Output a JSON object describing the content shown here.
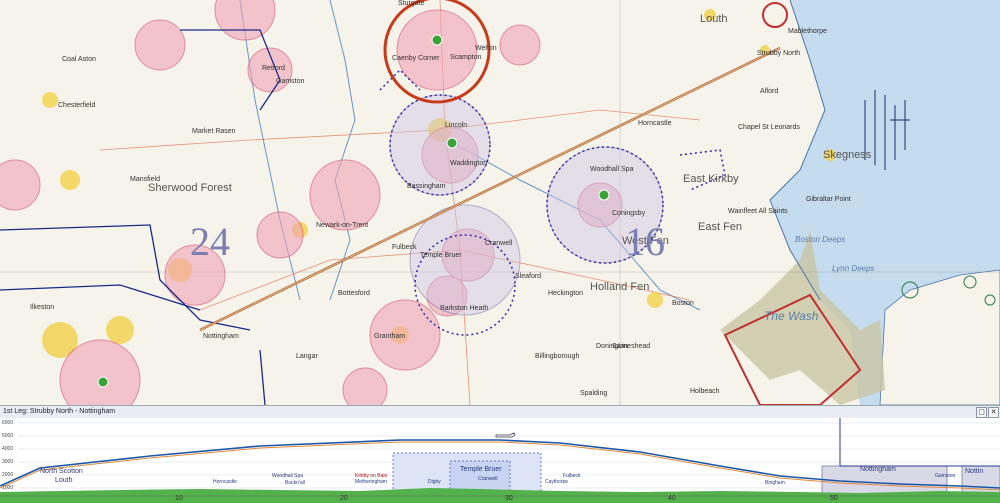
{
  "map": {
    "places": [
      {
        "text": "Sturgate"
      },
      {
        "text": "Caenby Corner"
      },
      {
        "text": "Scampton"
      },
      {
        "text": "Welton"
      },
      {
        "text": "Lincoln"
      },
      {
        "text": "Waddington"
      },
      {
        "text": "Bassingham"
      },
      {
        "text": "Coningsby"
      },
      {
        "text": "Woodhall Spa"
      },
      {
        "text": "East Kirkby"
      },
      {
        "text": "Skegness"
      },
      {
        "text": "Strubby North"
      },
      {
        "text": "Louth"
      },
      {
        "text": "Mablethorpe"
      },
      {
        "text": "Alford"
      },
      {
        "text": "Horncastle"
      },
      {
        "text": "Boston"
      },
      {
        "text": "Sleaford"
      },
      {
        "text": "Cranwell"
      },
      {
        "text": "Barkston Heath"
      },
      {
        "text": "Nottingham"
      },
      {
        "text": "Newark-on-Trent"
      },
      {
        "text": "Langar"
      },
      {
        "text": "Grantham"
      },
      {
        "text": "Gamston"
      },
      {
        "text": "Retford"
      },
      {
        "text": "Sherwood Forest"
      },
      {
        "text": "Chesterfield"
      },
      {
        "text": "Mansfield"
      },
      {
        "text": "Ilkeston"
      },
      {
        "text": "Market Rasen"
      },
      {
        "text": "Fulbeck"
      },
      {
        "text": "Temple Bruer"
      },
      {
        "text": "Bottesford"
      },
      {
        "text": "Heckington"
      },
      {
        "text": "Swineshead"
      },
      {
        "text": "Donington"
      },
      {
        "text": "Billingborough"
      },
      {
        "text": "Coal Aston"
      },
      {
        "text": "Wainfleet All Saints"
      },
      {
        "text": "Chapel St Leonards"
      },
      {
        "text": "Gibraltar Point"
      },
      {
        "text": "Spalding"
      },
      {
        "text": "Holbeach"
      }
    ],
    "features": {
      "wash": "The Wash",
      "lynn_deeps": "Lynn Deeps",
      "boston_deeps": "Boston Deeps",
      "west_fen": "West Fen",
      "east_fen": "East Fen",
      "holland_fen": "Holland Fen",
      "sector_24": "24",
      "sector_16": "16"
    }
  },
  "profile": {
    "title": "1st Leg: Strubby North - Nottingham",
    "btn_dock": "▢",
    "btn_close": "✕",
    "y_ticks": [
      "6000",
      "5000",
      "4000",
      "3000",
      "2000",
      "1000"
    ],
    "x_ticks": [
      "10",
      "20",
      "30",
      "40",
      "50"
    ],
    "labels": {
      "north_scotton": "North Scotton",
      "louth": "Louth",
      "horncastle": "Horncastle",
      "woodhall_spa": "Woodhall Spa",
      "buckell": "Buckn'all",
      "kirkby": "Kirkby on Bain",
      "metheringham": "Metheringham",
      "digby": "Digby",
      "temple_bruer": "Temple Bruer",
      "cranwell": "Cranwell",
      "caythorpe": "Caythorpe",
      "fulbeck": "Fulbeck",
      "bingham": "Bingham",
      "nottingham": "Nottingham",
      "gamston": "Gamston",
      "notts": "Nottin"
    }
  },
  "colors": {
    "sea": "#c5dcef",
    "land": "#f6f3ea",
    "restricted": "#f2a4b8",
    "atz": "#6a55a0",
    "route": "#b06a3a",
    "terrain": "#54b24c",
    "profile_line": "#1a57a8"
  }
}
